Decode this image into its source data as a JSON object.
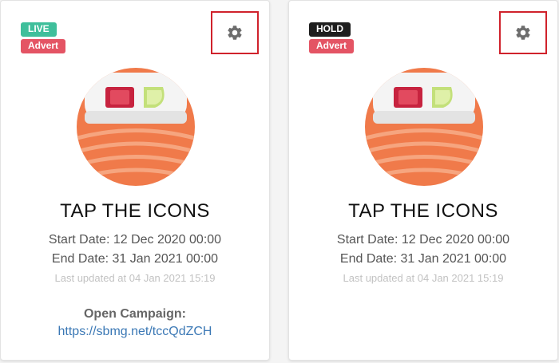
{
  "cards": [
    {
      "status_badge": "LIVE",
      "status_color": "#3fbf9b",
      "type_badge": "Advert",
      "type_color": "#e45464",
      "title": "TAP THE ICONS",
      "start_date": "Start Date: 12 Dec 2020 00:00",
      "end_date": "End Date: 31 Jan 2021 00:00",
      "last_updated": "Last updated at 04 Jan 2021 15:19",
      "open_campaign_label": "Open Campaign:",
      "open_campaign_url": "https://sbmg.net/tccQdZCH"
    },
    {
      "status_badge": "HOLD",
      "status_color": "#1e1e1e",
      "type_badge": "Advert",
      "type_color": "#e45464",
      "title": "TAP THE ICONS",
      "start_date": "Start Date: 12 Dec 2020 00:00",
      "end_date": "End Date: 31 Jan 2021 00:00",
      "last_updated": "Last updated at 04 Jan 2021 15:19"
    }
  ],
  "icons": {
    "settings": "gear-icon",
    "illustration": "sushi-roll-icon"
  }
}
